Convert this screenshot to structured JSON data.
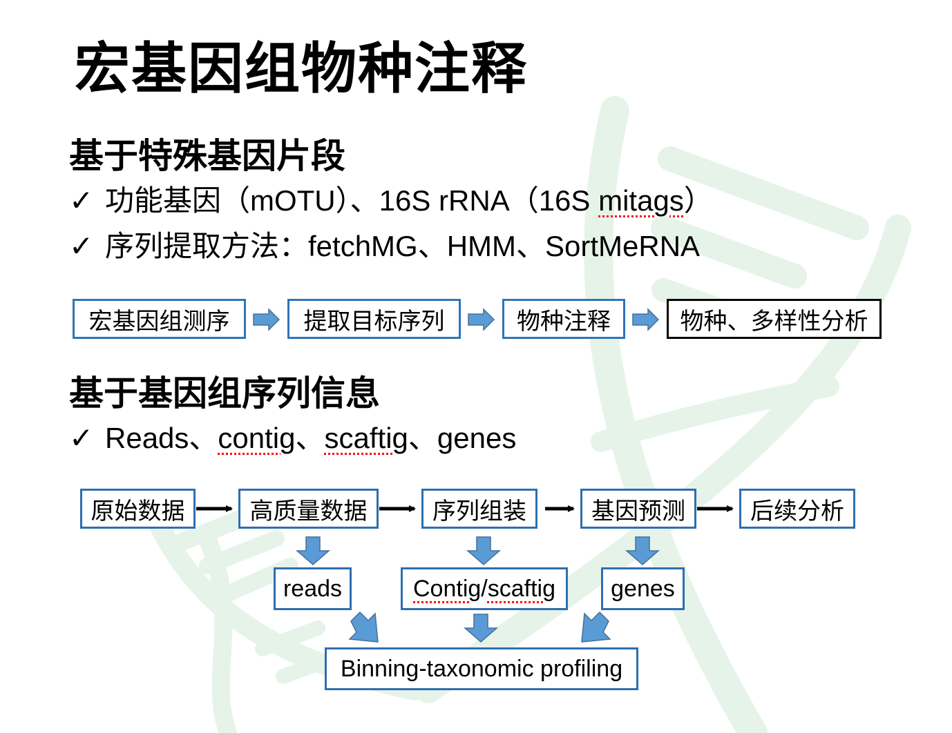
{
  "slide": {
    "title": "宏基因组物种注释",
    "section1": {
      "heading": "基于特殊基因片段",
      "bullets": [
        {
          "icon": "check-icon",
          "parts": [
            "功能基因（mOTU）、16S rRNA（16S ",
            "mitags",
            "）"
          ]
        },
        {
          "icon": "check-icon",
          "text": "序列提取方法：fetchMG、HMM、SortMeRNA"
        }
      ],
      "flow": [
        "宏基因组测序",
        "提取目标序列",
        "物种注释",
        "物种、多样性分析"
      ]
    },
    "section2": {
      "heading": "基于基因组序列信息",
      "bullet": {
        "icon": "check-icon",
        "parts": [
          "Reads、",
          "contig",
          "、",
          "scaftig",
          "、genes"
        ]
      },
      "flow_top": [
        "原始数据",
        "高质量数据",
        "序列组装",
        "基因预测",
        "后续分析"
      ],
      "flow_mid": {
        "reads": "reads",
        "contig_a": "Contig",
        "contig_sep": "/",
        "contig_b": "scaftig",
        "genes": "genes"
      },
      "flow_bottom": "Binning-taxonomic profiling"
    },
    "colors": {
      "box_border_blue": "#2e75b6",
      "arrow_fill": "#5b9bd5",
      "arrow_stroke": "#41719c",
      "watermark_green": "#e3f2e6",
      "spellcheck_red": "#ff0000"
    }
  }
}
